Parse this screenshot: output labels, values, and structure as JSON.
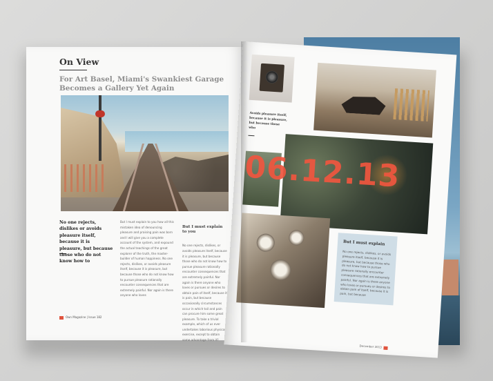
{
  "left_page": {
    "section_label": "On View",
    "headline": "For Art Basel, Miami's Swankiest Garage Becomes a Gallery Yet Again",
    "lead_text": "No one rejects, dislikes or avoids pleasure itself, because it is pleasure, but because those who do not know how to",
    "column1": "But I must explain to you how all this mistaken idea of denouncing pleasure and praising pain was born and I will give you a complete account of the system, and expound the actual teachings of the great explorer of the truth, the master-builder of human happiness. No one rejects, dislikes, or avoids pleasure itself, because it is pleasure, but because those who do not know how to pursue pleasure rationally encounter consequences that are extremely painful. Nor again is there anyone who loves",
    "column2_heading": "But I must explain to you",
    "column2": "No one rejects, dislikes, or avoids pleasure itself, because it is pleasure, but because those who do not know how to pursue pleasure rationally encounter consequences that are extremely painful. Nor again is there anyone who loves or pursues or desires to obtain pain of itself, because it is pain, but because occasionally circumstances occur in which toil and pain can procure him some great pleasure. To take a trivial example, which of us ever undertakes laborious physical exercise, except to obtain some advantage from it?",
    "footer_text": "Own Magazine | Issue 182"
  },
  "right_page": {
    "pull_text": "Avoids pleasure itself, because it is pleasure, but because those who",
    "big_date": "06.12.13",
    "box_heading": "But I must explain",
    "box_text": "No one rejects, dislikes, or avoids pleasure itself, because it is pleasure, but because those who do not know how to pursue pleasure rationally encounter consequences that are extremely painful. Nor again is there anyone who loves or pursues or desires to obtain pain of itself, because it is pain, but because",
    "footer_text": "December 2013"
  },
  "colors": {
    "accent": "#f0563f",
    "box_bg": "#cfdde6"
  }
}
